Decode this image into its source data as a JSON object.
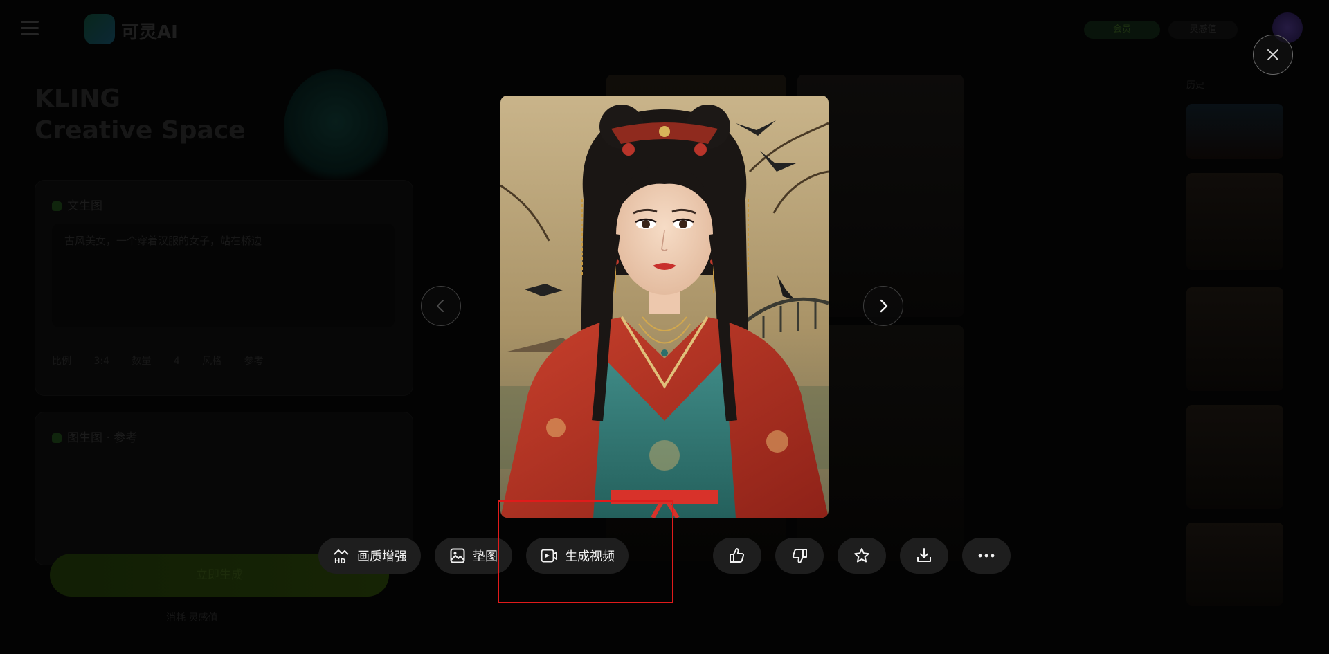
{
  "background_app": {
    "brand": "可灵AI",
    "vip_badge": "会员",
    "credits_label": "灵感值",
    "hero_title_line1": "KLING",
    "hero_title_line2": "Creative Space",
    "card1_title": "文生图",
    "prompt_text": "古风美女，一个穿着汉服的女子，站在桥边",
    "option_row": "比例 3:4 数量 4 风格 参考",
    "card2_title": "图生图 · 参考",
    "generate_label": "立即生成",
    "generate_sub": "消耗 灵感值",
    "rail_header": "历史"
  },
  "viewer": {
    "colors": {
      "button_bg": "#1e1e1e",
      "highlight": "#e01b1b"
    },
    "actions": {
      "hd_label": "画质增强",
      "pad_label": "垫图",
      "video_label": "生成视频"
    },
    "icon_buttons": [
      "thumbs-up",
      "thumbs-down",
      "star",
      "download",
      "more"
    ]
  }
}
